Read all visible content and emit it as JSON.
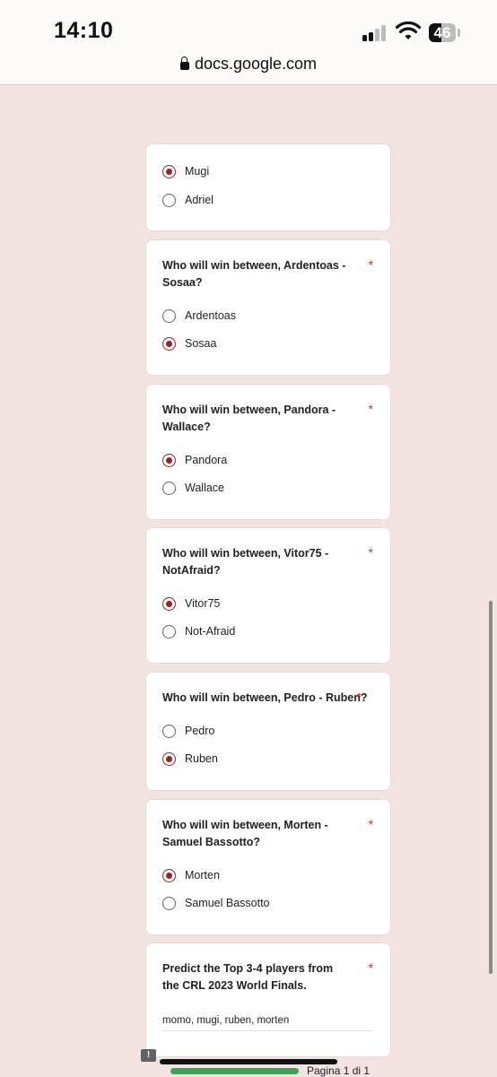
{
  "status_bar": {
    "time": "14:10",
    "battery": "46"
  },
  "browser": {
    "url": "docs.google.com"
  },
  "form": {
    "partial_card": {
      "options": [
        {
          "label": "Mugi",
          "selected": true
        },
        {
          "label": "Adriel",
          "selected": false
        }
      ]
    },
    "questions": [
      {
        "text": "Who will win between, Ardentoas - Sosaa?",
        "required_mark": "*",
        "options": [
          {
            "label": "Ardentoas",
            "selected": false
          },
          {
            "label": "Sosaa",
            "selected": true
          }
        ]
      },
      {
        "text": "Who will win between, Pandora - Wallace?",
        "required_mark": "*",
        "options": [
          {
            "label": "Pandora",
            "selected": true
          },
          {
            "label": "Wallace",
            "selected": false
          }
        ]
      },
      {
        "text": "Who will win between, Vitor75 - NotAfraid?",
        "required_mark": "*",
        "options": [
          {
            "label": "Vitor75",
            "selected": true
          },
          {
            "label": "Not-Afraid",
            "selected": false
          }
        ]
      },
      {
        "text": "Who will win between, Pedro - Ruben?",
        "required_mark": "*",
        "options": [
          {
            "label": "Pedro",
            "selected": false
          },
          {
            "label": "Ruben",
            "selected": true
          }
        ]
      },
      {
        "text": "Who will win between, Morten - Samuel Bassotto?",
        "required_mark": "*",
        "options": [
          {
            "label": "Morten",
            "selected": true
          },
          {
            "label": "Samuel Bassotto",
            "selected": false
          }
        ]
      }
    ],
    "text_question": {
      "text": "Predict the Top 3-4 players from the CRL 2023 World Finals.",
      "required_mark": "*",
      "answer": "momo, mugi, ruben, morten"
    }
  },
  "footer": {
    "page_indicator": "Pagina 1 di 1",
    "progress": 1.0,
    "feedback_icon_glyph": "!"
  },
  "colors": {
    "accent": "#9b2124",
    "background": "#f3e4e2",
    "required": "#d93025",
    "progress": "#37a852"
  }
}
